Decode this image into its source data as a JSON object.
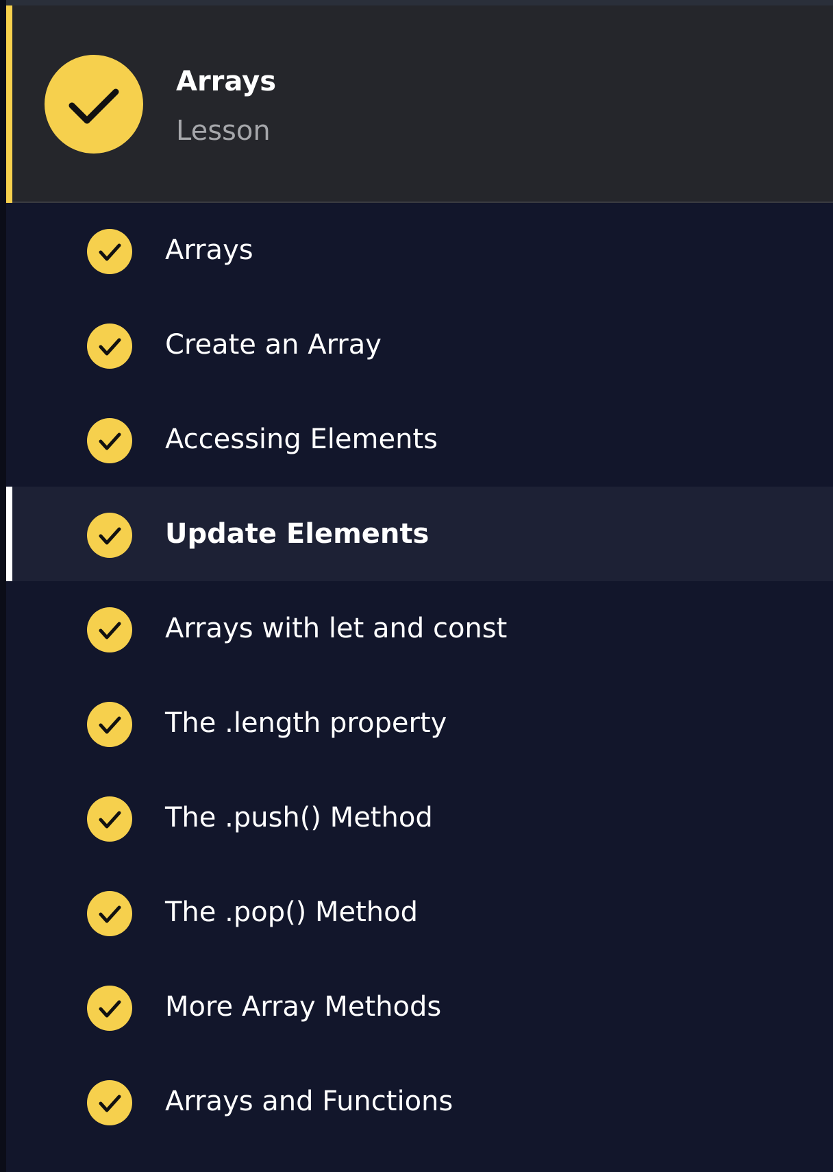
{
  "lesson": {
    "title": "Arrays",
    "type_label": "Lesson",
    "completed_icon": "checkmark-icon"
  },
  "colors": {
    "accent": "#f6d04d",
    "header_bg": "#25262b",
    "list_bg": "#12162b",
    "active_bg": "#1d2135"
  },
  "items": [
    {
      "label": "Arrays",
      "completed": true,
      "active": false
    },
    {
      "label": "Create an Array",
      "completed": true,
      "active": false
    },
    {
      "label": "Accessing Elements",
      "completed": true,
      "active": false
    },
    {
      "label": "Update Elements",
      "completed": true,
      "active": true
    },
    {
      "label": "Arrays with let and const",
      "completed": true,
      "active": false
    },
    {
      "label": "The .length property",
      "completed": true,
      "active": false
    },
    {
      "label": "The .push() Method",
      "completed": true,
      "active": false
    },
    {
      "label": "The .pop() Method",
      "completed": true,
      "active": false
    },
    {
      "label": "More Array Methods",
      "completed": true,
      "active": false
    },
    {
      "label": "Arrays and Functions",
      "completed": true,
      "active": false
    }
  ]
}
